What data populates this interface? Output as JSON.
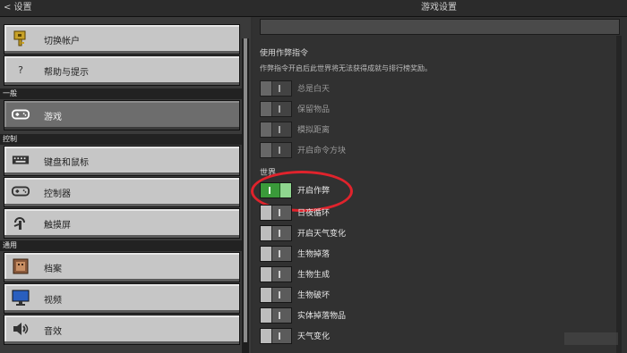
{
  "topbar": {
    "back_label": "< 设置",
    "title": "游戏设置"
  },
  "sidebar": {
    "sections": [
      {
        "header": ""
      },
      {
        "header": "一般"
      },
      {
        "header": "控制"
      },
      {
        "header": "通用"
      }
    ],
    "items": [
      {
        "label": "切换帐户",
        "icon": "key-icon"
      },
      {
        "label": "帮助与提示",
        "icon": "question-icon"
      },
      {
        "label": "游戏",
        "icon": "gamepad-icon"
      },
      {
        "label": "键盘和鼠标",
        "icon": "keyboard-icon"
      },
      {
        "label": "控制器",
        "icon": "controller-icon"
      },
      {
        "label": "触摸屏",
        "icon": "touch-icon"
      },
      {
        "label": "档案",
        "icon": "profile-icon"
      },
      {
        "label": "视频",
        "icon": "monitor-icon"
      },
      {
        "label": "音效",
        "icon": "speaker-icon"
      }
    ]
  },
  "panel": {
    "cheats_group": "使用作弊指令",
    "cheats_desc": "作弊指令开启后此世界将无法获得成就与排行榜奖励。",
    "cheat_toggles": [
      {
        "label": "总是白天",
        "on": false
      },
      {
        "label": "保留物品",
        "on": false
      },
      {
        "label": "模拟距离",
        "on": false
      },
      {
        "label": "开启命令方块",
        "on": false
      }
    ],
    "world_group": "世界",
    "world_toggles": [
      {
        "label": "开启作弊",
        "on": true
      },
      {
        "label": "日夜循环",
        "on": false
      },
      {
        "label": "开启天气变化",
        "on": false
      },
      {
        "label": "生物掉落",
        "on": false
      },
      {
        "label": "生物生成",
        "on": false
      },
      {
        "label": "生物破坏",
        "on": false
      },
      {
        "label": "实体掉落物品",
        "on": false
      },
      {
        "label": "天气变化",
        "on": false
      }
    ]
  },
  "colors": {
    "highlight": "#e0232c",
    "toggle_on": "#3a9a3a"
  }
}
